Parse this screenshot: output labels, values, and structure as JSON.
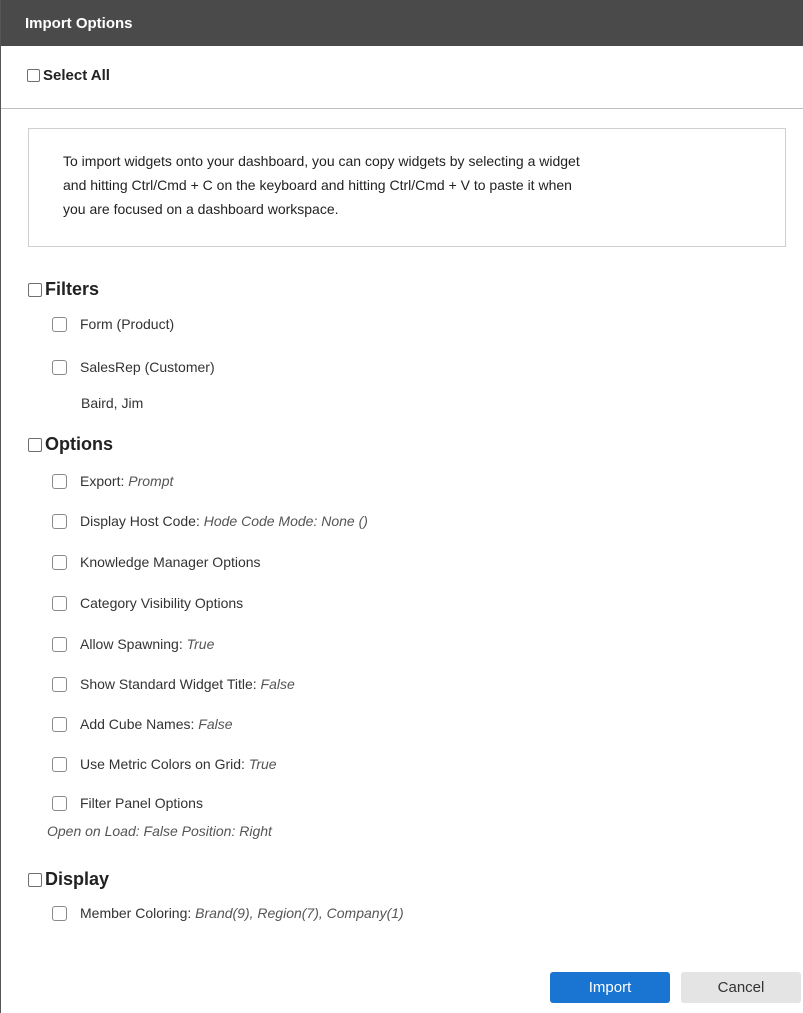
{
  "dialog": {
    "title": "Import Options",
    "select_all_label": "Select All",
    "info_lines": [
      "To import widgets onto your dashboard, you can copy widgets by selecting a widget",
      "and hitting Ctrl/Cmd + C on the keyboard and hitting Ctrl/Cmd + V to paste it when",
      "you are focused on a dashboard workspace."
    ]
  },
  "sections": {
    "filters": {
      "label": "Filters",
      "items": [
        {
          "label": "Form (Product)",
          "value": ""
        },
        {
          "label": "SalesRep (Customer)",
          "value": "",
          "note": "Baird, Jim"
        }
      ]
    },
    "options": {
      "label": "Options",
      "items": [
        {
          "label": "Export: ",
          "value": "Prompt"
        },
        {
          "label": "Display Host Code: ",
          "value": "Hode Code Mode: None ()"
        },
        {
          "label": "Knowledge Manager Options",
          "value": ""
        },
        {
          "label": "Category Visibility Options",
          "value": ""
        },
        {
          "label": "Allow Spawning: ",
          "value": "True"
        },
        {
          "label": "Show Standard Widget Title: ",
          "value": "False"
        },
        {
          "label": "Add Cube Names: ",
          "value": "False"
        },
        {
          "label": "Use Metric Colors on Grid: ",
          "value": "True"
        },
        {
          "label": "Filter Panel Options",
          "value": "",
          "note": "Open on Load: False Position: Right"
        }
      ]
    },
    "display": {
      "label": "Display",
      "items": [
        {
          "label": "Member Coloring: ",
          "value": "Brand(9), Region(7), Company(1)"
        }
      ]
    }
  },
  "buttons": {
    "import_label": "Import",
    "cancel_label": "Cancel",
    "primary_color": "#1a75d2"
  }
}
